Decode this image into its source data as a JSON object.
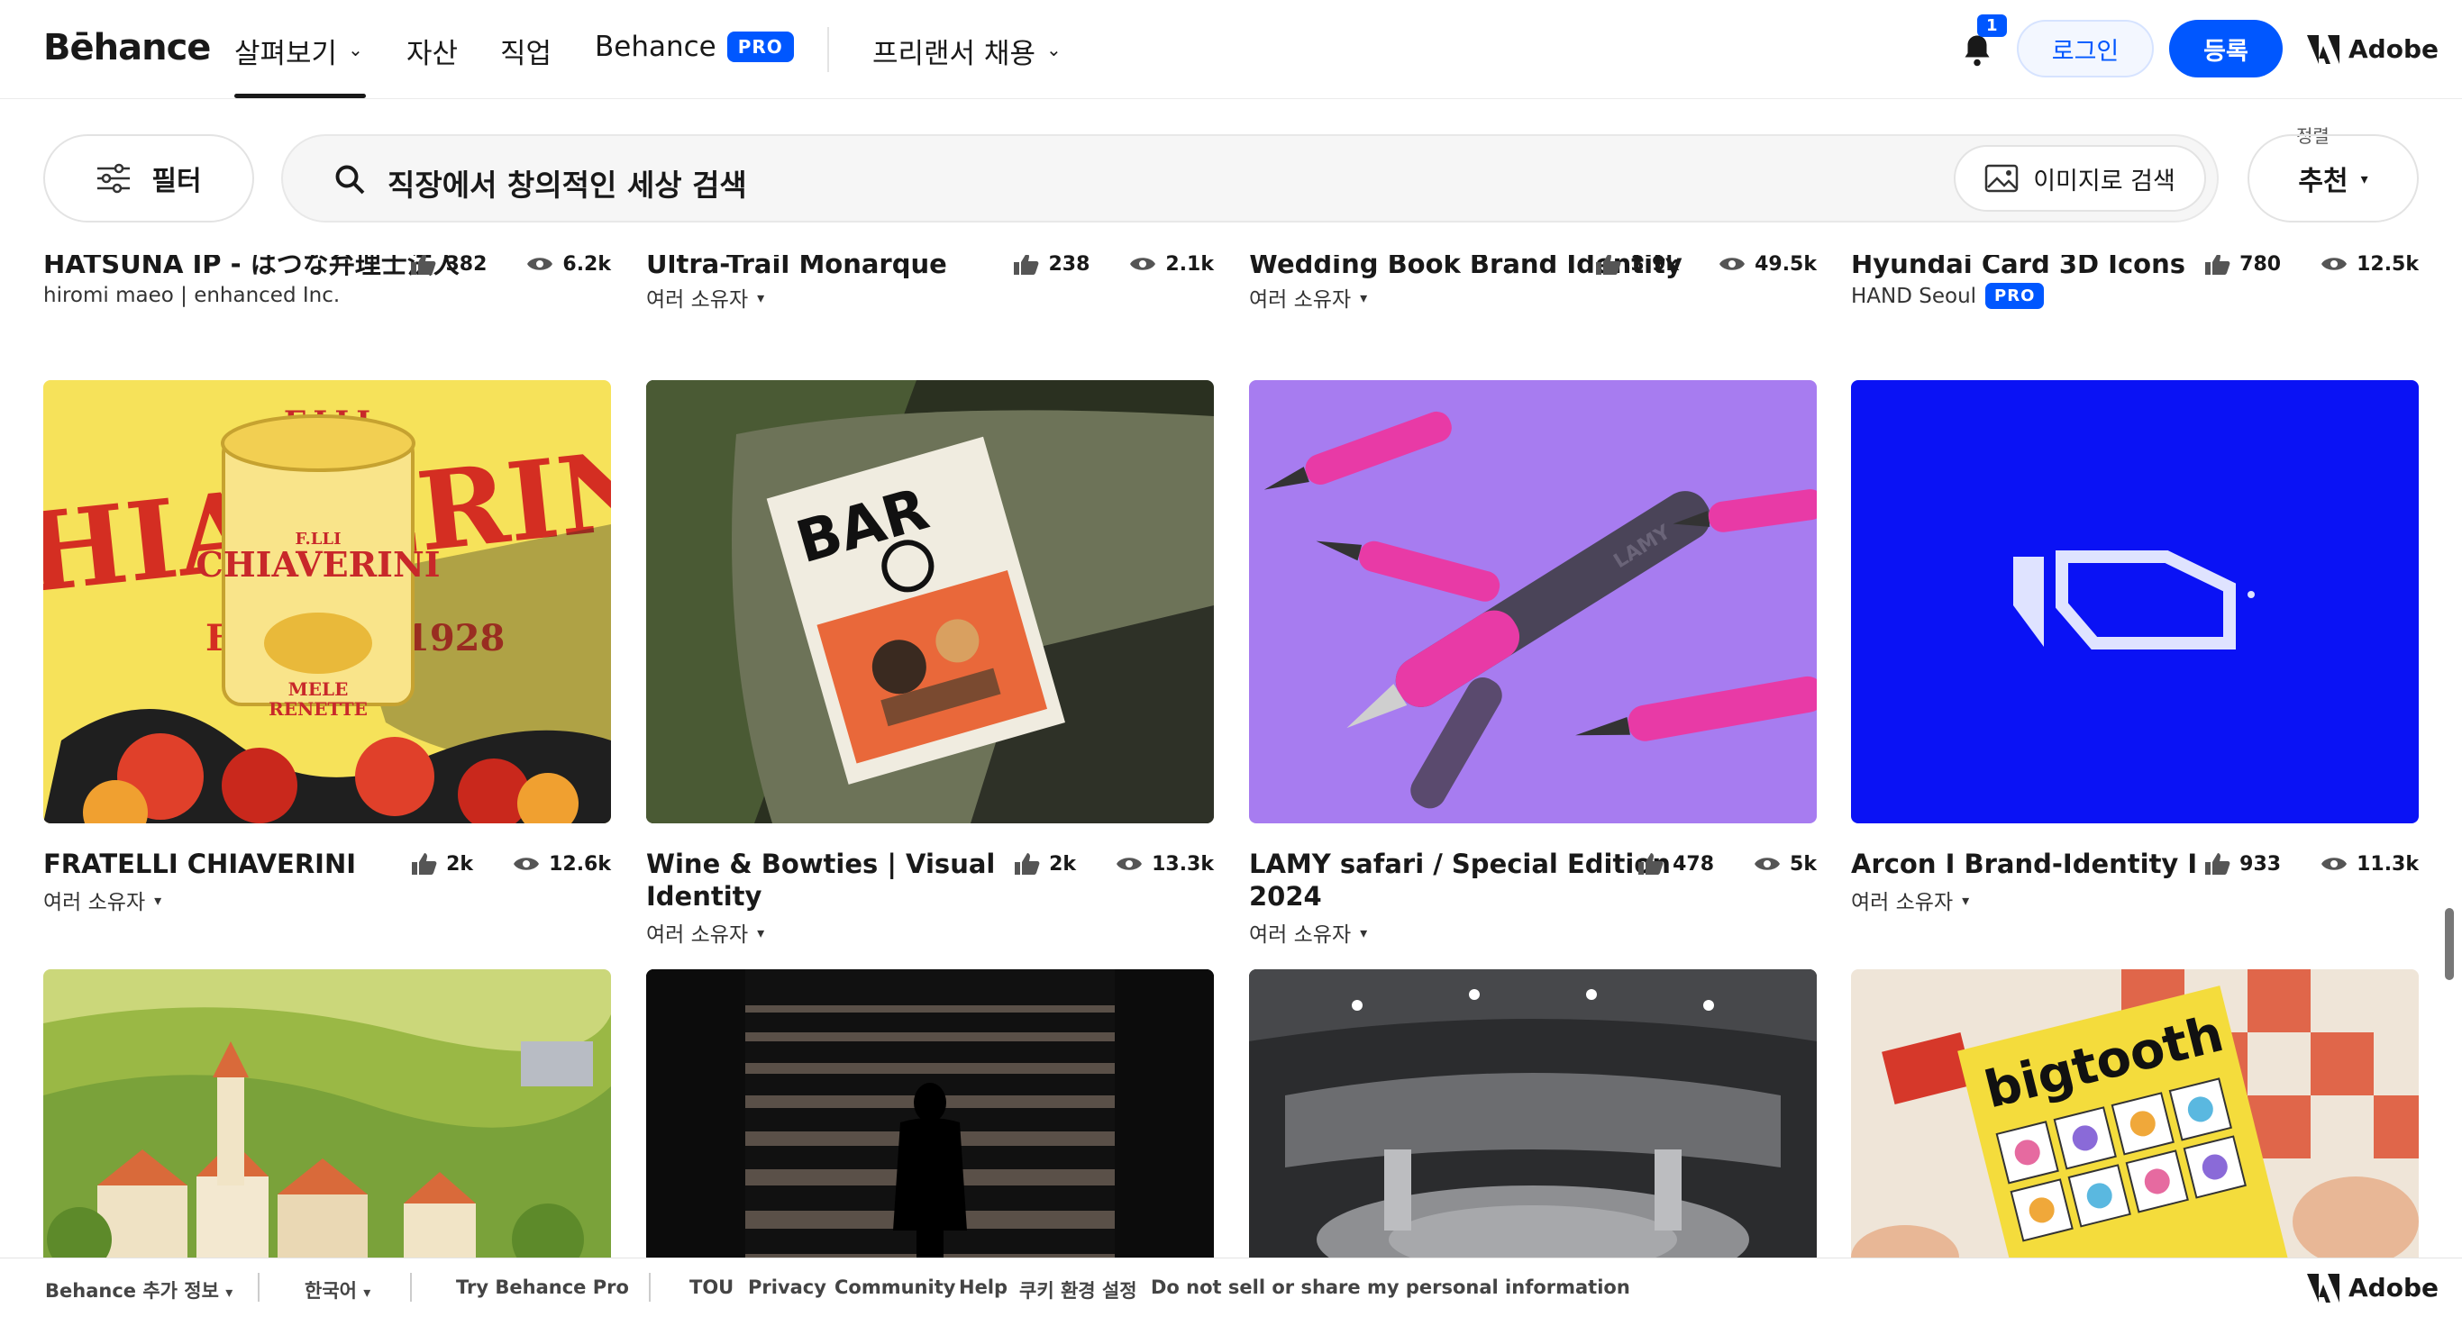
{
  "nav": {
    "logo": "Bēhance",
    "explore": "살펴보기",
    "assets": "자산",
    "jobs": "직업",
    "behance_pro": "Behance",
    "pro_badge": "PRO",
    "hire_freelancers": "프리랜서 채용",
    "notification_count": "1",
    "login": "로그인",
    "signup": "등록",
    "adobe": "Adobe"
  },
  "search": {
    "filter_label": "필터",
    "query": "직장에서 창의적인 세상 검색",
    "image_search_label": "이미지로 검색",
    "sort_label": "정렬",
    "sort_value": "추천"
  },
  "projects_top": [
    {
      "title": "HATSUNA IP - はつな弁理士法人",
      "owner": "hiromi maeo | enhanced Inc.",
      "likes": "382",
      "views": "6.2k"
    },
    {
      "title": "Ultra-Trail Monarque",
      "owner": "여러 소유자",
      "likes": "238",
      "views": "2.1k"
    },
    {
      "title": "Wedding Book Brand Identity",
      "owner": "여러 소유자",
      "likes": "3.9k",
      "views": "49.5k"
    },
    {
      "title": "Hyundai Card 3D Icons",
      "owner": "HAND Seoul",
      "owner_badge": "PRO",
      "likes": "780",
      "views": "12.5k"
    }
  ],
  "projects_mid": [
    {
      "title": "FRATELLI CHIAVERINI",
      "owner": "여러 소유자",
      "likes": "2k",
      "views": "12.6k",
      "art": {
        "top": "F.LLI",
        "brand": "CHIAVERINI",
        "can_brand": "F.LLI",
        "can_name": "CHIAVERINI",
        "city": "FIRENZE 1928",
        "mele": "MELE",
        "renette": "RENETTE"
      }
    },
    {
      "title_line1": "Wine & Bowties | Visual",
      "title_line2": "Identity",
      "owner": "여러 소유자",
      "likes": "2k",
      "views": "13.3k",
      "art": {
        "poster_text": "BAR"
      }
    },
    {
      "title_line1": "LAMY safari / Special Edition",
      "title_line2": "2024",
      "owner": "여러 소유자",
      "likes": "478",
      "views": "5k",
      "art": {
        "pen_text": "LAMY"
      }
    },
    {
      "title": "Arcon I Brand-Identity I",
      "owner": "여러 소유자",
      "likes": "933",
      "views": "11.3k"
    }
  ],
  "projects_bottom": [
    {
      "theme": "village-illustration"
    },
    {
      "theme": "staircase-photo"
    },
    {
      "theme": "hangar-render"
    },
    {
      "theme": "bigtooth-cards",
      "art_text": "bigtooth"
    }
  ],
  "footer": {
    "more_info": "Behance 추가 정보",
    "language": "한국어",
    "try_pro": "Try Behance Pro",
    "tou": "TOU",
    "privacy": "Privacy",
    "community": "Community",
    "help": "Help",
    "cookies": "쿠키 환경 설정",
    "do_not_sell": "Do not sell or share my personal information",
    "adobe": "Adobe"
  },
  "colors": {
    "accent": "#0057ff",
    "arcon_blue": "#0a12f5",
    "lamy_purple": "#a77cf0",
    "chiaverini_yellow": "#f6e25a"
  }
}
